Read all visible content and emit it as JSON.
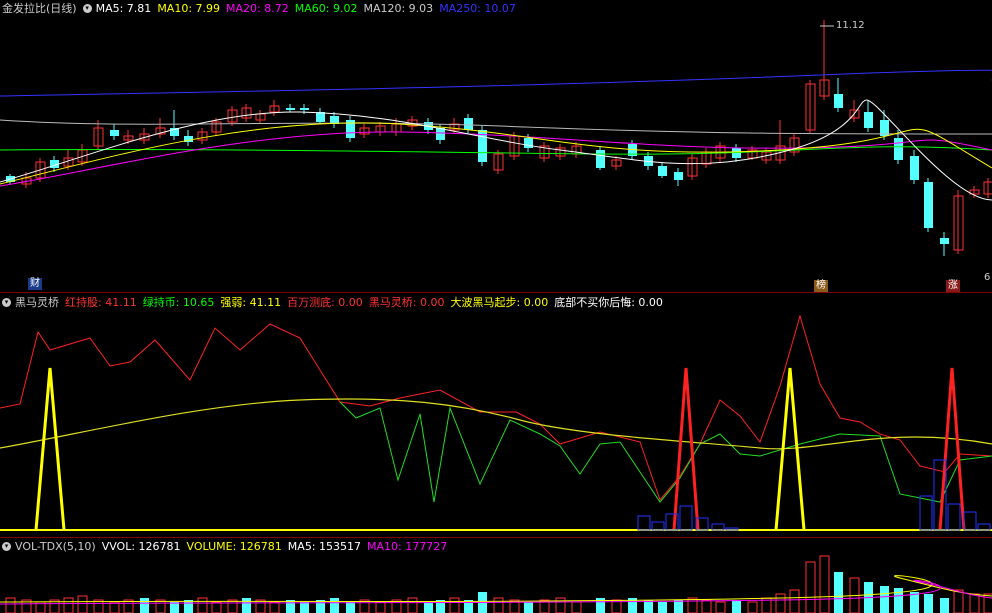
{
  "main": {
    "title": "金发拉比(日线)",
    "ma5": "MA5: 7.81",
    "ma10": "MA10: 7.99",
    "ma20": "MA20: 8.72",
    "ma60": "MA60: 9.02",
    "ma120": "MA120: 9.03",
    "ma250": "MA250: 10.07",
    "peak_label": "11.12",
    "tag_left": "财",
    "tag_mid": "榜",
    "tag_right": "涨",
    "edge_label": "6"
  },
  "indicator": {
    "name": "黑马灵桥",
    "red": "红持股: 41.11",
    "green": "绿持币: 10.65",
    "strong": "强弱: 41.11",
    "million": "百万测底: 0.00",
    "bridge": "黑马灵桥: 0.00",
    "wave": "大波黑马起步: 0.00",
    "bottom": "底部不买你后悔: 0.00"
  },
  "volume": {
    "name": "VOL-TDX(5,10)",
    "vvol": "VVOL: 126781",
    "vol": "VOLUME: 126781",
    "ma5": "MA5: 153517",
    "ma10": "MA10: 177727"
  },
  "colors": {
    "up": "#ff3232",
    "down": "#54ffff",
    "ma5": "#ffffff",
    "ma10": "#ffff00",
    "ma20": "#ff00ff",
    "ma60": "#00ff00",
    "ma120": "#bbbbbb",
    "ma250": "#3333ff"
  }
}
